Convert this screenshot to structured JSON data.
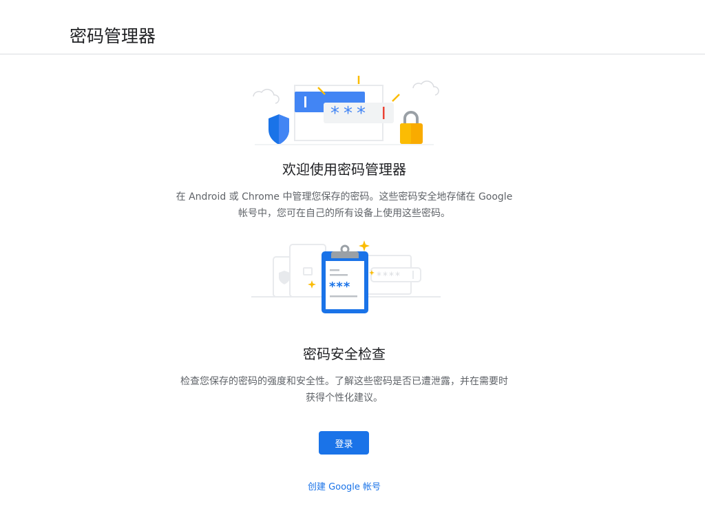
{
  "header": {
    "title": "密码管理器"
  },
  "welcome": {
    "title": "欢迎使用密码管理器",
    "description_line1": "在 Android 或 Chrome 中管理您保存的密码。这些密码安全地存储在 Google",
    "description_line2": "帐号中，您可在自己的所有设备上使用这些密码。"
  },
  "checkup": {
    "title": "密码安全检查",
    "description_line1": "检查您保存的密码的强度和安全性。了解这些密码是否已遭泄露，并在需要时",
    "description_line2": "获得个性化建议。"
  },
  "actions": {
    "signin_label": "登录",
    "create_account_label": "创建 Google 帐号"
  },
  "colors": {
    "accent": "#1a73e8",
    "secondary_text": "#5f6368",
    "divider": "#dadce0",
    "lock": "#f9ab00",
    "spark": "#fbbc04"
  }
}
